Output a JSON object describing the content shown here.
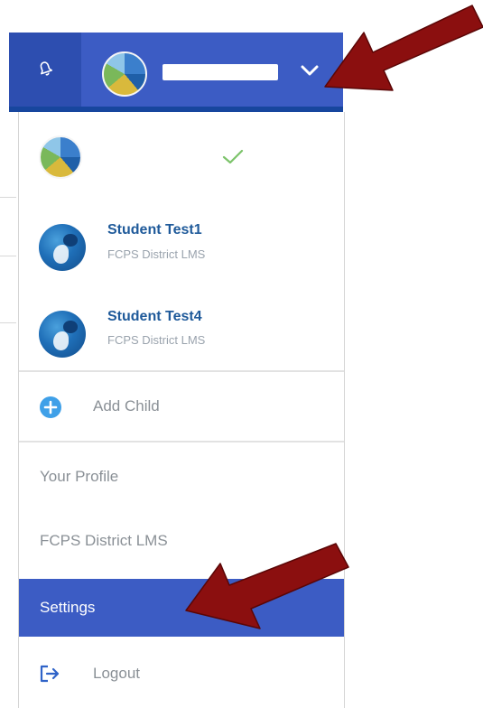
{
  "menu": {
    "children": [
      {
        "name": "Student Test1",
        "organization": "FCPS District LMS"
      },
      {
        "name": "Student Test4",
        "organization": "FCPS District LMS"
      }
    ],
    "add_child_label": "Add Child",
    "your_profile_label": "Your Profile",
    "district_label": "FCPS District LMS",
    "settings_label": "Settings",
    "logout_label": "Logout"
  },
  "icons": {
    "notifications": "bell-icon",
    "account_menu": "chevron-down-icon",
    "selected": "check-icon",
    "add_child": "plus-circle-icon",
    "logout": "logout-icon"
  },
  "colors": {
    "header_blue": "#3c5cc4",
    "bell_button_blue": "#2d4eb0",
    "header_underline": "#17469e",
    "settings_highlight": "#3c5cc4",
    "child_name_text": "#1f5a9a",
    "secondary_text": "#9aa3ad",
    "menu_text": "#8a9096",
    "check_green": "#7cc36a",
    "plus_blue": "#3fa0e8",
    "annotation_arrow": "#8b0f0f"
  }
}
